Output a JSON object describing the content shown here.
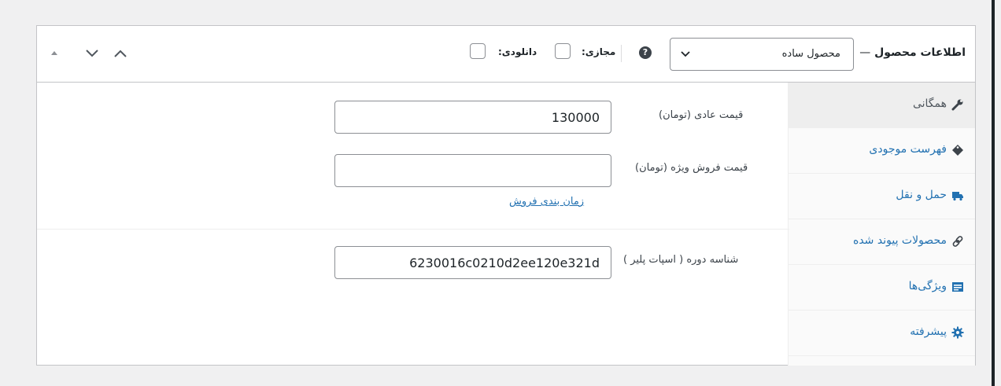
{
  "header": {
    "title": "اطلاعات محصول",
    "title_dash": "—",
    "product_type": "محصول ساده",
    "help": "?",
    "virtual_label": "مجازی:",
    "downloadable_label": "دانلودی:"
  },
  "tabs": [
    {
      "label": "همگانی",
      "icon": "wrench-icon"
    },
    {
      "label": "فهرست موجودی",
      "icon": "tag-icon"
    },
    {
      "label": "حمل و نقل",
      "icon": "truck-icon"
    },
    {
      "label": "محصولات پیوند شده",
      "icon": "link-icon"
    },
    {
      "label": "ویژگی‌ها",
      "icon": "list-icon"
    },
    {
      "label": "پیشرفته",
      "icon": "gear-icon"
    }
  ],
  "fields": {
    "regular_price": {
      "label": "قیمت عادی (تومان)",
      "value": "130000"
    },
    "sale_price": {
      "label": "قیمت فروش ویژه (تومان)",
      "value": "",
      "schedule_link": "زمان بندی فروش"
    },
    "course_id": {
      "label": "شناسه دوره ( اسپات پلیر )",
      "value": "6230016c0210d2ee120e321d"
    }
  },
  "colors": {
    "link": "#2271b1",
    "border": "#c3c4c7",
    "active_tab_bg": "#eeeeee"
  }
}
